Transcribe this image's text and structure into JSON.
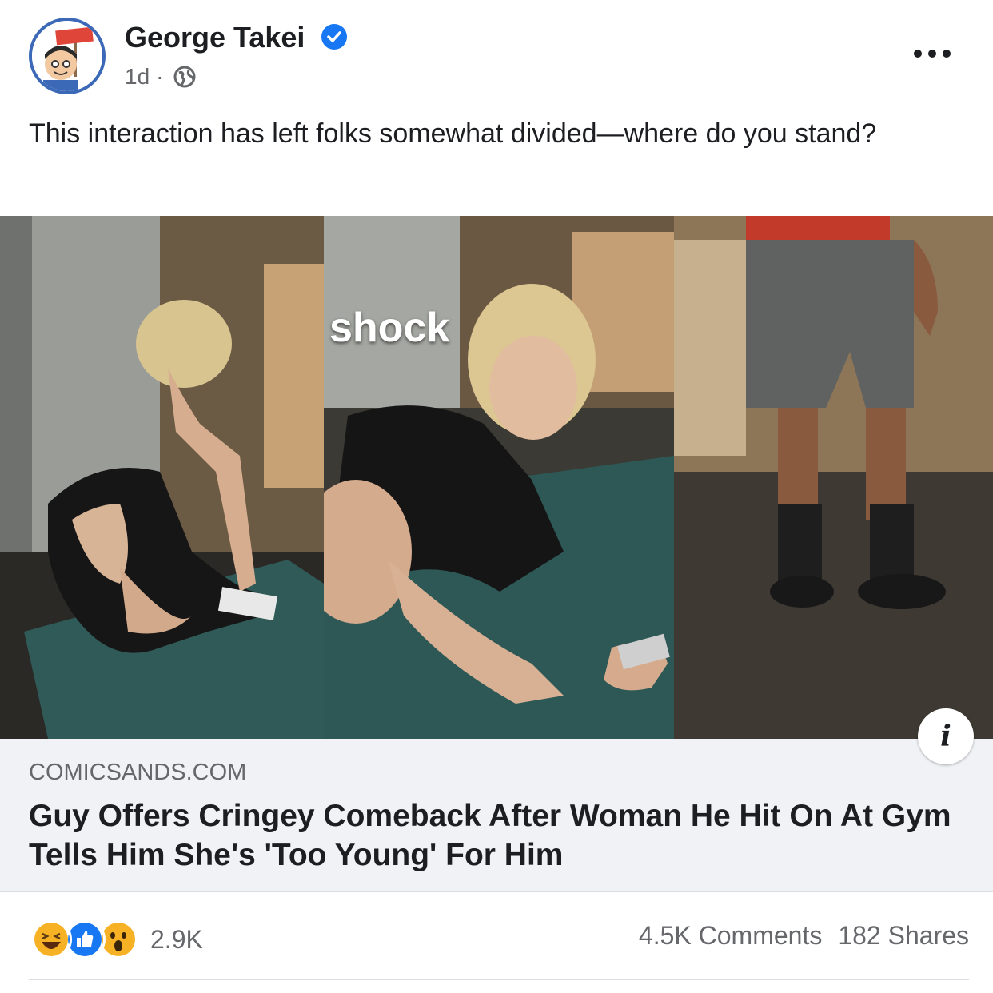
{
  "post": {
    "author": "George Takei",
    "time": "1d",
    "separator": "·",
    "caption": "This interaction has left folks somewhat divided—where do you stand?"
  },
  "media": {
    "overlay_text": "shock",
    "info_label": "i"
  },
  "link": {
    "domain": "COMICSANDS.COM",
    "headline": "Guy Offers Cringey Comeback After Woman He Hit On At Gym Tells Him She's 'Too Young' For Him"
  },
  "engagement": {
    "reaction_icons": [
      "haha-reaction-icon",
      "like-reaction-icon",
      "wow-reaction-icon"
    ],
    "reaction_count": "2.9K",
    "comments": "4.5K Comments",
    "shares": "182 Shares"
  },
  "colors": {
    "verified": "#1877f2",
    "like": "#1877f2",
    "haha": "#f7b125",
    "secondary_text": "#65676b",
    "link_bg": "#f0f2f5"
  }
}
